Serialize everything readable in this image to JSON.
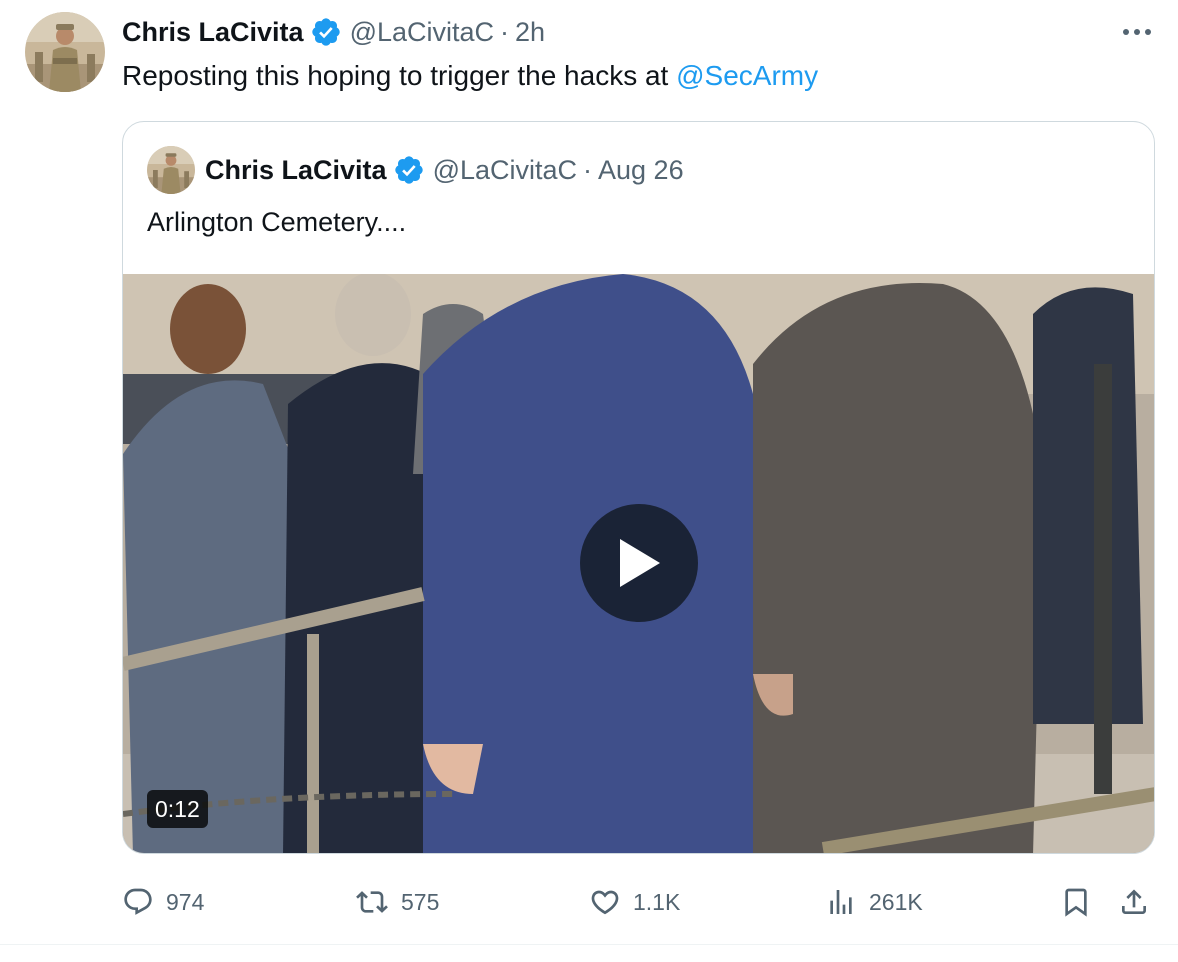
{
  "tweet": {
    "author": {
      "display_name": "Chris LaCivita",
      "handle": "@LaCivitaC",
      "verified": true
    },
    "separator": "·",
    "time": "2h",
    "text_before": "Reposting this hoping to trigger the hacks at ",
    "mention": "@SecArmy",
    "more_icon": "more-horizontal-icon"
  },
  "quoted": {
    "author": {
      "display_name": "Chris LaCivita",
      "handle": "@LaCivitaC",
      "verified": true
    },
    "separator": "·",
    "time": "Aug 26",
    "text": "Arlington Cemetery....",
    "video": {
      "duration": "0:12",
      "play_icon": "play-icon"
    }
  },
  "actions": {
    "replies": "974",
    "reposts": "575",
    "likes": "1.1K",
    "views": "261K"
  },
  "colors": {
    "accent": "#1d9bf0",
    "text": "#0f1419",
    "secondary": "#536471",
    "border": "#cfd9de"
  }
}
